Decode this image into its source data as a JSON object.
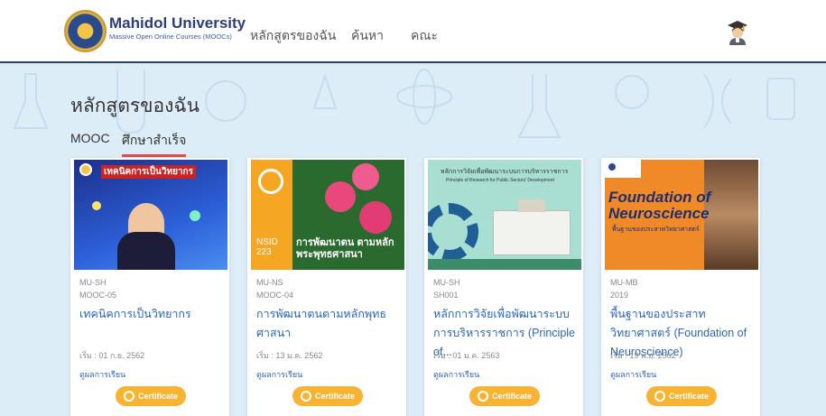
{
  "header": {
    "logo_title": "Mahidol University",
    "logo_subtitle": "Massive Open Online Courses (MOOCs)",
    "nav": [
      "หลักสูตรของฉัน",
      "ค้นหา",
      "คณะ"
    ]
  },
  "hero": {
    "title": "หลักสูตรของฉัน",
    "tabs": [
      "MOOC",
      "ศึกษาสำเร็จ"
    ]
  },
  "cards": [
    {
      "faculty": "MU-SH",
      "code": "MOOC-05",
      "title": "เทคนิคการเป็นวิทยากร",
      "start": "เริ่ม : 01 ก.ย. 2562",
      "result": "ดูผลการเรียน",
      "cert": "Certificate",
      "thumb_text": "เทคนิคการเป็นวิทยากร"
    },
    {
      "faculty": "MU-NS",
      "code": "MOOC-04",
      "title": "การพัฒนาตนตามหลักพุทธศาสนา",
      "start": "เริ่ม : 13 ม.ค. 2562",
      "result": "ดูผลการเรียน",
      "cert": "Certificate",
      "thumb_code": "NSID 223",
      "thumb_text": "การพัฒนาตน ตามหลักพระพุทธศาสนา"
    },
    {
      "faculty": "MU-SH",
      "code": "SH001",
      "title": "หลักการวิจัยเพื่อพัฒนาระบบการบริหารราชการ (Principle of...",
      "start": "เริ่ม : 01 ม.ค. 2563",
      "result": "ดูผลการเรียน",
      "cert": "Certificate",
      "thumb_text": "หลักการวิจัยเพื่อพัฒนาระบบการบริหารราชการ",
      "thumb_sub": "Principle of Research for Public Sectors' Development"
    },
    {
      "faculty": "MU-MB",
      "code": "2019",
      "title": "พื้นฐานของประสาทวิทยาศาสตร์ (Foundation of Neuroscience)",
      "start": "เริ่ม : 19 พ.ย. 2562",
      "result": "ดูผลการเรียน",
      "cert": "Certificate",
      "thumb_title1": "Foundation of",
      "thumb_title2": "Neuroscience",
      "thumb_text": "พื้นฐานของประสาทวิทยาศาสตร์"
    }
  ],
  "colors": {
    "accent_blue": "#2a66b8",
    "cert_orange": "#f7b334",
    "hero_bg": "#dcedf8",
    "tab_underline": "#e44a4a"
  }
}
